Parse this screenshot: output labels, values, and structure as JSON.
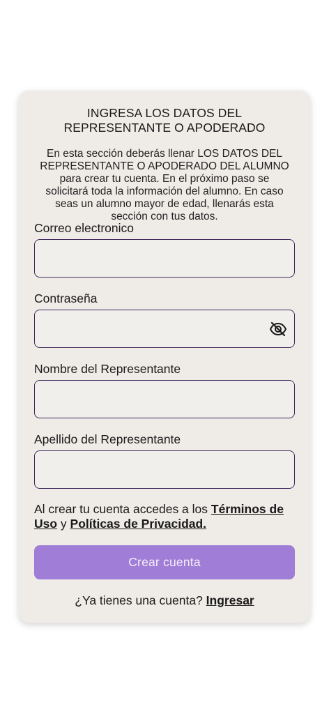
{
  "form": {
    "title": "INGRESA LOS DATOS DEL REPRESENTANTE O APODERADO",
    "description": "En esta sección deberás llenar LOS DATOS DEL REPRESENTANTE O APODERADO DEL ALUMNO para crear tu cuenta. En el próximo paso se solicitará toda la información del alumno. En caso seas un alumno mayor de edad, llenarás esta sección con tus datos.",
    "fields": {
      "email": {
        "label": "Correo electronico",
        "value": "",
        "placeholder": ""
      },
      "password": {
        "label": "Contraseña",
        "value": "",
        "placeholder": "",
        "toggle_icon": "eye-off-icon"
      },
      "first_name": {
        "label": "Nombre del Representante",
        "value": "",
        "placeholder": ""
      },
      "last_name": {
        "label": "Apellido del Representante",
        "value": "",
        "placeholder": ""
      }
    },
    "terms": {
      "prefix": "Al crear tu cuenta accedes a los ",
      "terms_link": "Términos de Uso",
      "connector": " y ",
      "privacy_link": "Políticas de Privacidad."
    },
    "submit_label": "Crear cuenta",
    "login": {
      "prompt": "¿Ya tienes una cuenta? ",
      "link": "Ingresar"
    }
  },
  "colors": {
    "card_bg": "#efebe7",
    "input_border": "#3f2a5c",
    "button_bg": "#a07dd6",
    "button_text": "#f4eefa"
  }
}
